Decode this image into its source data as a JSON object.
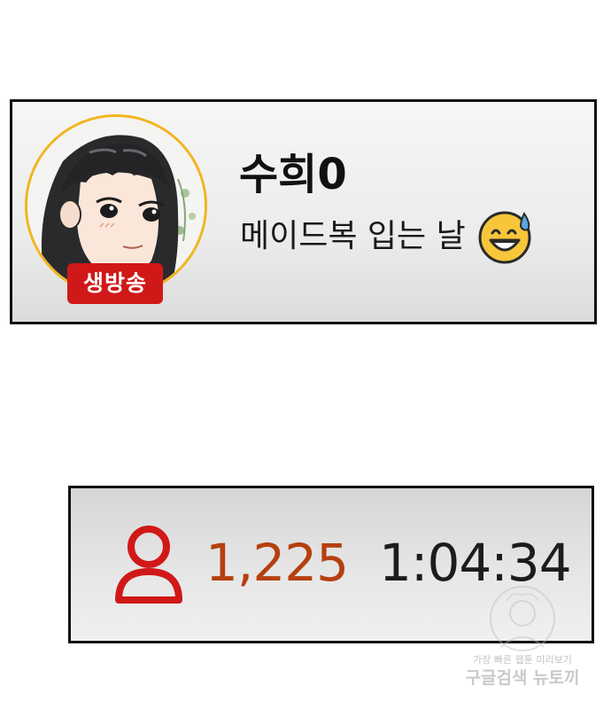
{
  "stream": {
    "streamer_name": "수희0",
    "title": "메이드복 입는 날",
    "live_badge": "생방송",
    "title_emoji": "grinning-sweat-emoji-icon",
    "avatar": "avatar-portrait-image"
  },
  "stats": {
    "viewer_icon": "person-icon",
    "viewer_count": "1,225",
    "elapsed_time": "1:04:34"
  },
  "watermark": {
    "subtitle": "가장 빠른 웹툰 미리보기",
    "title": "구글검색 뉴토끼"
  },
  "colors": {
    "live_badge_bg": "#d11818",
    "avatar_ring": "#f2b51e",
    "viewer_accent": "#b5400f",
    "viewer_icon": "#d11818",
    "card_border": "#111111"
  }
}
